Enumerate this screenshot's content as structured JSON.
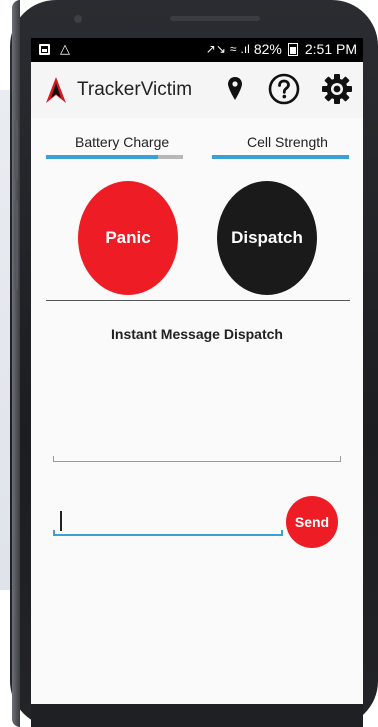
{
  "status_bar": {
    "battery_percent": "82%",
    "time": "2:51 PM",
    "signal_glyph": ".ıl",
    "wifi_glyph": "≈",
    "icons": [
      "image-notification-icon",
      "app-notification-icon",
      "mute-icon",
      "wifi-icon",
      "signal-icon",
      "battery-icon"
    ]
  },
  "app_bar": {
    "title": "TrackerVictim",
    "logo_color": "#d71920",
    "icons": [
      "location-pin-icon",
      "help-icon",
      "settings-gear-icon"
    ]
  },
  "meters": {
    "battery": {
      "label": "Battery Charge",
      "level": 0.82
    },
    "cell": {
      "label": "Cell Strength",
      "level": 1.0
    }
  },
  "actions": {
    "panic_label": "Panic",
    "dispatch_label": "Dispatch"
  },
  "messages": {
    "section_title": "Instant Message Dispatch",
    "input_value": "",
    "send_label": "Send"
  },
  "colors": {
    "accent_blue": "#3ba0d4",
    "panic_red": "#ee1c25",
    "dispatch_black": "#1a1a1a"
  }
}
